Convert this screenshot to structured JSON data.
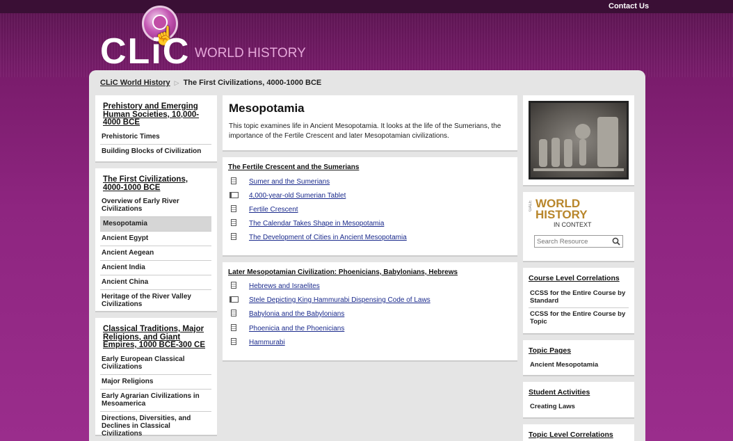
{
  "header": {
    "contact_label": "Contact Us",
    "logo_main": "CLiC",
    "logo_sub": "WORLD HISTORY"
  },
  "breadcrumb": {
    "home": "CLiC World History",
    "current": "The First Civilizations, 4000-1000 BCE"
  },
  "left_nav": [
    {
      "heading": "Prehistory and Emerging Human Societies, 10,000-4000 BCE",
      "items": [
        "Prehistoric Times",
        "Building Blocks of Civilization"
      ]
    },
    {
      "heading": "The First Civilizations, 4000-1000 BCE",
      "items": [
        "Overview of Early River Civilizations",
        "Mesopotamia",
        "Ancient Egypt",
        "Ancient Aegean",
        "Ancient India",
        "Ancient China",
        "Heritage of the River Valley Civilizations"
      ],
      "active_index": 1
    },
    {
      "heading": "Classical Traditions, Major Religions, and Giant Empires, 1000 BCE-300 CE",
      "items": [
        "Early European Classical Civilizations",
        "Major Religions",
        "Early Agrarian Civilizations in Mesoamerica",
        "Directions, Diversities, and Declines in Classical Civilizations"
      ]
    }
  ],
  "main": {
    "title": "Mesopotamia",
    "description": "This topic examines life in Ancient Mesopotamia. It looks at the life of the Sumerians, the importance of the Fertile Crescent and later Mesopotamian civilizations.",
    "sections": [
      {
        "heading": "The Fertile Crescent and the Sumerians",
        "links": [
          {
            "label": "Sumer and the Sumerians",
            "icon": "document-icon"
          },
          {
            "label": "4,000-year-old Sumerian Tablet",
            "icon": "film-icon"
          },
          {
            "label": "Fertile Crescent",
            "icon": "document-icon"
          },
          {
            "label": "The Calendar Takes Shape in Mesopotamia",
            "icon": "document-icon"
          },
          {
            "label": "The Development of Cities in Ancient Mesopotamia",
            "icon": "document-icon"
          }
        ]
      },
      {
        "heading": "Later Mesopotamian Civilization: Phoenicians, Babylonians, Hebrews",
        "links": [
          {
            "label": "Hebrews and Israelites",
            "icon": "document-icon"
          },
          {
            "label": "Stele Depicting King Hammurabi Dispensing Code of Laws",
            "icon": "film-icon"
          },
          {
            "label": "Babylonia and the Babylonians",
            "icon": "document-icon"
          },
          {
            "label": "Phoenicia and the Phoenicians",
            "icon": "document-icon"
          },
          {
            "label": "Hammurabi",
            "icon": "document-icon"
          }
        ]
      }
    ]
  },
  "right": {
    "whic": {
      "gale": "GALE",
      "line1": "WORLD",
      "line2": "HISTORY",
      "line3": "IN CONTEXT"
    },
    "search_placeholder": "Search Resource",
    "course_correlations": {
      "heading": "Course Level Correlations",
      "items": [
        "CCSS for the Entire Course by Standard",
        "CCSS for the Entire Course by Topic"
      ]
    },
    "topic_pages": {
      "heading": "Topic Pages",
      "items": [
        "Ancient Mesopotamia"
      ]
    },
    "student_activities": {
      "heading": "Student Activities",
      "items": [
        "Creating Laws"
      ]
    },
    "topic_correlations": {
      "heading": "Topic Level Correlations"
    }
  }
}
